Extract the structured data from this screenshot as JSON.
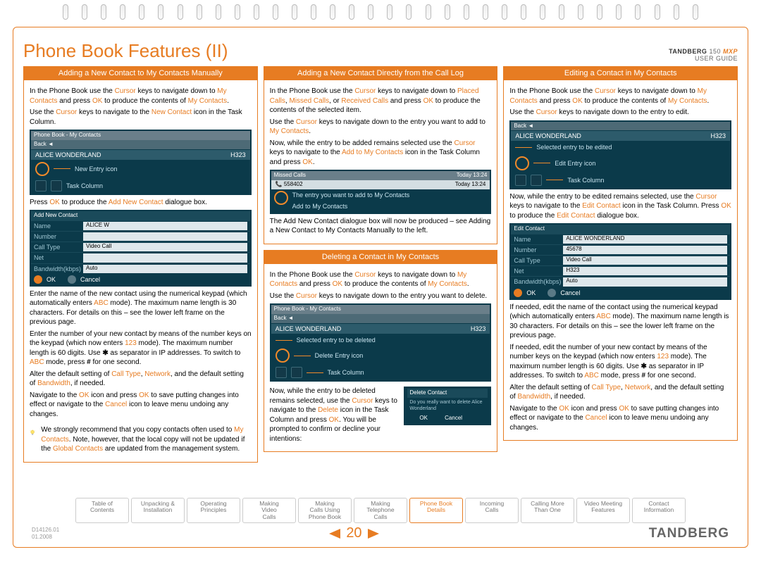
{
  "product": {
    "brand": "TANDBERG",
    "model": "150",
    "suffix": "MXP",
    "subtitle": "USER GUIDE"
  },
  "title": "Phone Book Features (II)",
  "col1": {
    "h": "Adding a New Contact to My Contacts Manually",
    "p1a": "In the Phone Book use the ",
    "p1b": "Cursor",
    "p1c": " keys to navigate down to ",
    "p1d": "My Contacts",
    "p1e": " and press ",
    "p1f": "OK",
    "p1g": " to produce the contents of ",
    "p1h": "My Contacts",
    "p1i": ".",
    "p2a": "Use the ",
    "p2b": "Cursor",
    "p2c": " keys to navigate to the ",
    "p2d": "New Contact",
    "p2e": " icon in the Task Column.",
    "shot1": {
      "bar": "Phone Book - My Contacts",
      "back": "Back ◄",
      "name": "ALICE WONDERLAND",
      "proto": "H323",
      "lbl1": "New Entry icon",
      "lbl2": "Task Column"
    },
    "p3a": "Press ",
    "p3b": "OK",
    "p3c": " to produce the ",
    "p3d": "Add New Contact",
    "p3e": " dialogue box.",
    "form": {
      "hdr": "Add New Contact",
      "r1l": "Name",
      "r1v": "ALICE W",
      "r2l": "Number",
      "r3l": "Call Type",
      "r3v": "Video Call",
      "r4l": "Net",
      "r5l": "Bandwidth(kbps)",
      "r5v": "Auto",
      "ok": "OK",
      "cancel": "Cancel"
    },
    "p4a": "Enter the name of the new contact using the numerical keypad (which automatically enters ",
    "p4b": "ABC",
    "p4c": " mode). The maximum name length is 30 characters. For details on this – see the lower left frame on the previous page.",
    "p5a": "Enter the number of your new contact by means of the number keys on the keypad (which now enters ",
    "p5b": "123",
    "p5c": " mode). The maximum number length is 60 digits. Use ",
    "p5d": "✱",
    "p5e": " as separator in IP addresses. To switch to ",
    "p5f": "ABC",
    "p5g": " mode, press ",
    "p5h": "#",
    "p5i": " for one second.",
    "p6a": "Alter the default setting of ",
    "p6b": "Call Type",
    "p6c": ", ",
    "p6d": "Network",
    "p6e": ", and the default setting of ",
    "p6f": "Bandwidth",
    "p6g": ", if needed.",
    "p7a": "Navigate to the ",
    "p7b": "OK",
    "p7c": " icon and press ",
    "p7d": "OK",
    "p7e": " to save putting changes into effect or navigate to the ",
    "p7f": "Cancel",
    "p7g": " icon to leave menu undoing any changes.",
    "tip1": "We strongly recommend that you copy contacts often used to ",
    "tip2": "My Contacts",
    "tip3": ". Note, however, that the local copy will not be updated if the ",
    "tip4": "Global Contacts",
    "tip5": " are updated from the management system."
  },
  "col2a": {
    "h": "Adding a New Contact Directly from the Call Log",
    "p1a": "In the Phone Book use the ",
    "p1b": "Cursor",
    "p1c": " keys to navigate down to ",
    "p1d": "Placed Calls",
    "p1e": ", ",
    "p1f": "Missed Calls",
    "p1g": ", or ",
    "p1h": "Received Calls",
    "p1i": " and press ",
    "p1j": "OK",
    "p1k": " to produce the contents of the selected item.",
    "p2a": "Use the ",
    "p2b": "Cursor",
    "p2c": " keys to navigate down to the entry you want to add to ",
    "p2d": "My Contacts",
    "p2e": ".",
    "p3a": "Now, while the entry to be added remains selected use the ",
    "p3b": "Cursor",
    "p3c": " keys to navigate to the ",
    "p3d": "Add to My Contacts",
    "p3e": " icon in the Task Column and press ",
    "p3f": "OK",
    "p3g": ".",
    "shot": {
      "bar": "Missed Calls",
      "num": "558402",
      "time": "Today 13:24",
      "lbl1": "The entry you want to add to My Contacts",
      "lbl2": "Add to My Contacts"
    },
    "p4": "The Add New Contact dialogue box will now be produced – see Adding a New Contact to My Contacts Manually to the left."
  },
  "col2b": {
    "h": "Deleting a Contact in My Contacts",
    "p1a": "In the Phone Book use the ",
    "p1b": "Cursor",
    "p1c": " keys to navigate down to ",
    "p1d": "My Contacts",
    "p1e": " and press ",
    "p1f": "OK",
    "p1g": " to produce the contents of ",
    "p1h": "My Contacts",
    "p1i": ".",
    "p2a": "Use the ",
    "p2b": "Cursor",
    "p2c": " keys to navigate down to the entry you want to delete.",
    "shot": {
      "bar": "Phone Book - My Contacts",
      "back": "Back ◄",
      "name": "ALICE WONDERLAND",
      "proto": "H323",
      "lbl1": "Selected entry to be deleted",
      "lbl2": "Delete Entry icon",
      "lbl3": "Task Column"
    },
    "p3a": "Now, while the entry to be deleted remains selected, use the ",
    "p3b": "Cursor",
    "p3c": " keys to navigate to the ",
    "p3d": "Delete",
    "p3e": " icon in the Task Column and press ",
    "p3f": "OK",
    "p3g": ". You will be prompted to confirm or decline your intentions:",
    "confirm": {
      "hdr": "Delete Contact",
      "q": "Do you really want to delete Alice Wonderland",
      "ok": "OK",
      "cancel": "Cancel"
    }
  },
  "col3": {
    "h": "Editing a Contact in My Contacts",
    "p1a": "In the Phone Book use the ",
    "p1b": "Cursor",
    "p1c": " keys to navigate down to ",
    "p1d": "My Contacts",
    "p1e": " and press ",
    "p1f": "OK",
    "p1g": " to produce the contents of ",
    "p1h": "My Contacts",
    "p1i": ".",
    "p2a": "Use the ",
    "p2b": "Cursor",
    "p2c": " keys to navigate down to the entry to edit.",
    "shot": {
      "bar": "Back ◄",
      "name": "ALICE WONDERLAND",
      "proto": "H323",
      "lbl1": "Selected entry to be edited",
      "lbl2": "Edit Entry icon",
      "lbl3": "Task Column"
    },
    "p3a": "Now, while the entry to be edited remains selected, use the ",
    "p3b": "Cursor",
    "p3c": " keys to navigate to the ",
    "p3d": "Edit Contact",
    "p3e": " icon in the Task Column. Press ",
    "p3f": "OK",
    "p3g": " to produce the ",
    "p3h": "Edit Contact",
    "p3i": " dialogue box.",
    "form": {
      "hdr": "Edit Contact",
      "r1l": "Name",
      "r1v": "ALICE WONDERLAND",
      "r2l": "Number",
      "r2v": "45678",
      "r3l": "Call Type",
      "r3v": "Video Call",
      "r4l": "Net",
      "r4v": "H323",
      "r5l": "Bandwidth(kbps)",
      "r5v": "Auto",
      "ok": "OK",
      "cancel": "Cancel"
    },
    "p4a": "If needed, edit the name of the contact using the numerical keypad (which automatically enters ",
    "p4b": "ABC",
    "p4c": " mode). The maximum name length is 30 characters. For details on this – see the lower left frame on the previous page.",
    "p5a": "If needed, edit the number of your new contact by means of the number keys on the keypad (which now enters ",
    "p5b": "123",
    "p5c": " mode). The maximum number length is 60 digits. Use ",
    "p5d": "✱",
    "p5e": " as separator in IP addresses. To switch to ",
    "p5f": "ABC",
    "p5g": " mode, press ",
    "p5h": "#",
    "p5i": " for one second.",
    "p6a": "Alter the default setting of ",
    "p6b": "Call Type",
    "p6c": ", ",
    "p6d": "Network",
    "p6e": ", and the default setting of ",
    "p6f": "Bandwidth",
    "p6g": ", if needed.",
    "p7a": "Navigate to the ",
    "p7b": "OK",
    "p7c": " icon and press ",
    "p7d": "OK",
    "p7e": " to save putting changes into effect or navigate to the ",
    "p7f": "Cancel",
    "p7g": " icon to leave menu undoing any changes."
  },
  "nav": [
    {
      "l1": "Table of",
      "l2": "Contents"
    },
    {
      "l1": "Unpacking &",
      "l2": "Installation"
    },
    {
      "l1": "Operating",
      "l2": "Principles"
    },
    {
      "l1": "Making",
      "l2": "Video",
      "l3": "Calls"
    },
    {
      "l1": "Making",
      "l2": "Calls Using",
      "l3": "Phone Book"
    },
    {
      "l1": "Making",
      "l2": "Telephone",
      "l3": "Calls"
    },
    {
      "l1": "Phone Book",
      "l2": "Details",
      "active": true
    },
    {
      "l1": "Incoming",
      "l2": "Calls"
    },
    {
      "l1": "Calling More",
      "l2": "Than One"
    },
    {
      "l1": "Video Meeting",
      "l2": "Features"
    },
    {
      "l1": "Contact",
      "l2": "Information"
    }
  ],
  "doc": {
    "id": "D14126.01",
    "date": "01.2008"
  },
  "page": "20",
  "brand": "TANDBERG"
}
